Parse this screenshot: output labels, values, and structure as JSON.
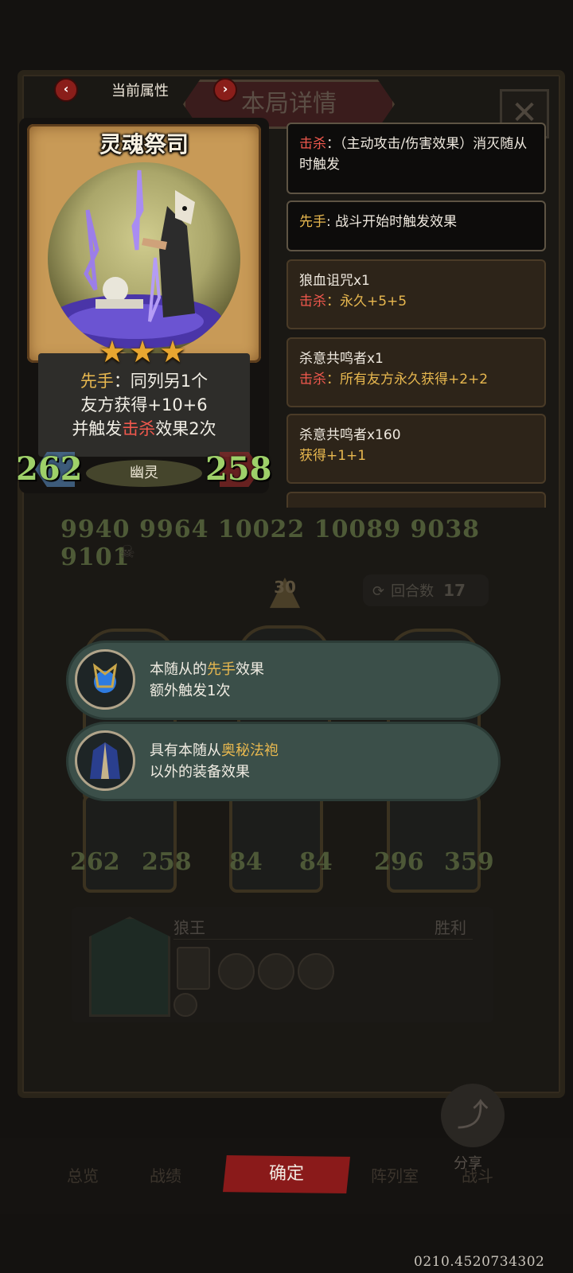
{
  "header": {
    "title": "当前属性",
    "bg_title": "本局详情",
    "close_glyph": "✕"
  },
  "card": {
    "name": "灵魂祭司",
    "stars": "★★★",
    "desc": {
      "kw1": "先手",
      "l1_rest": "：同列另1个",
      "l2": "友方获得+10+6",
      "l3_pre": "并触发",
      "kw2": "击杀",
      "l3_post": "效果2次"
    },
    "attack": "262",
    "health": "258",
    "tribe": "幽灵"
  },
  "keywords": [
    {
      "kw": "击杀",
      "text": "：（主动攻击/伤害效果）消灭随从时触发"
    },
    {
      "kw": "先手",
      "text": ": 战斗开始时触发效果"
    }
  ],
  "buffs": [
    {
      "name": "狼血诅咒x1",
      "kw": "击杀",
      "text": "：永久+5+5"
    },
    {
      "name": "杀意共鸣者x1",
      "kw": "击杀",
      "text": "：所有友方永久获得+2+2"
    },
    {
      "name": "杀意共鸣者x160",
      "kw": "",
      "text": "获得+1+1"
    }
  ],
  "board": {
    "top_stats": "9940 9964 10022 10089 9038 9101",
    "arrow_value": "30",
    "round_label": "回合数",
    "round_value": "17",
    "bottom_stats": [
      {
        "atk": "262",
        "hp": "258"
      },
      {
        "atk": "84",
        "hp": "84"
      },
      {
        "atk": "296",
        "hp": "359"
      }
    ]
  },
  "tooltips": [
    {
      "pre": "本随从的",
      "kw": "先手",
      "post": "效果",
      "line2": "额外触发1次"
    },
    {
      "pre": "具有本随从",
      "kw": "奥秘法袍",
      "post": "",
      "line2": "以外的装备效果"
    }
  ],
  "enemy": {
    "name": "狼王",
    "result": "胜利"
  },
  "tabs": [
    "总览",
    "战绩",
    "阵列室",
    "战斗"
  ],
  "confirm_label": "确定",
  "share_label": "分享",
  "coords": "0210.4520734302",
  "colors": {
    "gold_keyword": "#e8b84f",
    "red_keyword": "#f0584d",
    "stat_green": "#9ed069",
    "confirm_red": "#8a1a1a"
  }
}
